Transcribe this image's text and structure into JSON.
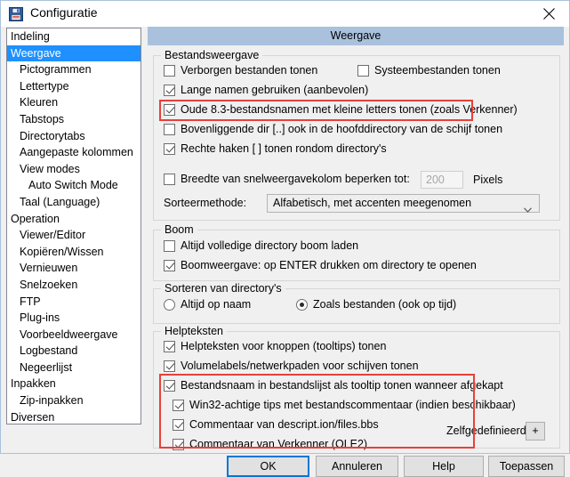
{
  "window": {
    "title": "Configuratie",
    "icon": "floppy-save-icon",
    "close_label": "✕"
  },
  "sidebar": {
    "items": [
      {
        "label": "Indeling",
        "level": 0,
        "selected": false
      },
      {
        "label": "Weergave",
        "level": 0,
        "selected": true
      },
      {
        "label": "Pictogrammen",
        "level": 1,
        "selected": false
      },
      {
        "label": "Lettertype",
        "level": 1,
        "selected": false
      },
      {
        "label": "Kleuren",
        "level": 1,
        "selected": false
      },
      {
        "label": "Tabstops",
        "level": 1,
        "selected": false
      },
      {
        "label": "Directorytabs",
        "level": 1,
        "selected": false
      },
      {
        "label": "Aangepaste kolommen",
        "level": 1,
        "selected": false
      },
      {
        "label": "View modes",
        "level": 1,
        "selected": false
      },
      {
        "label": "Auto Switch Mode",
        "level": 2,
        "selected": false
      },
      {
        "label": "Taal (Language)",
        "level": 1,
        "selected": false
      },
      {
        "label": "Operation",
        "level": 0,
        "selected": false
      },
      {
        "label": "Viewer/Editor",
        "level": 1,
        "selected": false
      },
      {
        "label": "Kopiëren/Wissen",
        "level": 1,
        "selected": false
      },
      {
        "label": "Vernieuwen",
        "level": 1,
        "selected": false
      },
      {
        "label": "Snelzoeken",
        "level": 1,
        "selected": false
      },
      {
        "label": "FTP",
        "level": 1,
        "selected": false
      },
      {
        "label": "Plug-ins",
        "level": 1,
        "selected": false
      },
      {
        "label": "Voorbeeldweergave",
        "level": 1,
        "selected": false
      },
      {
        "label": "Logbestand",
        "level": 1,
        "selected": false
      },
      {
        "label": "Negeerlijst",
        "level": 1,
        "selected": false
      },
      {
        "label": "Inpakken",
        "level": 0,
        "selected": false
      },
      {
        "label": "Zip-inpakken",
        "level": 1,
        "selected": false
      },
      {
        "label": "Diversen",
        "level": 0,
        "selected": false
      }
    ]
  },
  "panel": {
    "header": "Weergave",
    "groups": {
      "file_view": {
        "title": "Bestandsweergave",
        "options": [
          {
            "label": "Verborgen bestanden tonen",
            "checked": false
          },
          {
            "label": "Systeembestanden tonen",
            "checked": false
          },
          {
            "label": "Lange namen gebruiken (aanbevolen)",
            "checked": true
          },
          {
            "label": "Oude 8.3-bestandsnamen met kleine letters tonen (zoals Verkenner)",
            "checked": true
          },
          {
            "label": "Bovenliggende dir [..] ook in de hoofddirectory van de schijf tonen",
            "checked": false
          },
          {
            "label": "Rechte haken [ ] tonen rondom directory's",
            "checked": true
          },
          {
            "label": "Breedte van snelweergavekolom beperken tot:",
            "checked": false
          }
        ],
        "width_value": "200",
        "pixels_label": "Pixels",
        "sort_label": "Sorteermethode:",
        "sort_value": "Alfabetisch, met accenten meegenomen"
      },
      "tree": {
        "title": "Boom",
        "options": [
          {
            "label": "Altijd volledige directory boom laden",
            "checked": false
          },
          {
            "label": "Boomweergave: op ENTER drukken om directory te openen",
            "checked": true
          }
        ]
      },
      "dir_sort": {
        "title": "Sorteren van directory's",
        "options": [
          {
            "label": "Altijd op naam",
            "selected": false
          },
          {
            "label": "Zoals bestanden (ook op tijd)",
            "selected": true
          }
        ]
      },
      "help_text": {
        "title": "Helpteksten",
        "options": [
          {
            "label": "Helpteksten voor knoppen (tooltips) tonen",
            "checked": true
          },
          {
            "label": "Volumelabels/netwerkpaden voor schijven tonen",
            "checked": true
          },
          {
            "label": "Bestandsnaam in bestandslijst als tooltip tonen wanneer afgekapt",
            "checked": true
          },
          {
            "label": "Win32-achtige tips met bestandscommentaar (indien beschikbaar)",
            "checked": true
          },
          {
            "label": "Commentaar van descript.ion/files.bbs",
            "checked": true
          },
          {
            "label": "Commentaar van Verkenner (OLE2)",
            "checked": true
          }
        ],
        "custom_label": "Zelfgedefinieerd:",
        "custom_button": "+"
      }
    }
  },
  "buttons": {
    "ok": "OK",
    "cancel": "Annuleren",
    "help": "Help",
    "apply": "Toepassen"
  },
  "colors": {
    "header_bar": "#a9c1dd",
    "selection": "#1e90ff",
    "annotation": "#e8403a",
    "default_button_border": "#0078d7"
  }
}
